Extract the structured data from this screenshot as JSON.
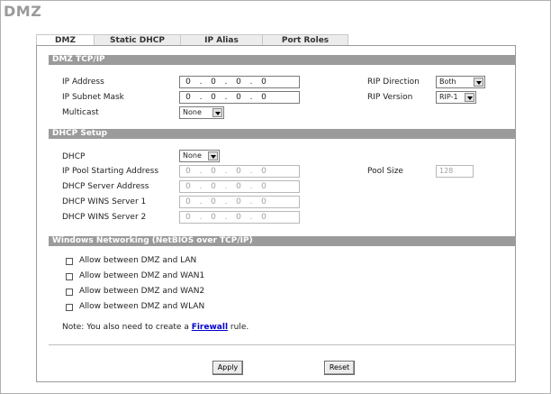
{
  "page": {
    "title": "DMZ"
  },
  "tabs": [
    {
      "label": "DMZ",
      "active": true
    },
    {
      "label": "Static DHCP",
      "active": false
    },
    {
      "label": "IP Alias",
      "active": false
    },
    {
      "label": "Port Roles",
      "active": false
    }
  ],
  "tcpip": {
    "heading": "DMZ TCP/IP",
    "ip_address_label": "IP Address",
    "ip_address": [
      "0",
      "0",
      "0",
      "0"
    ],
    "subnet_mask_label": "IP Subnet Mask",
    "subnet_mask": [
      "0",
      "0",
      "0",
      "0"
    ],
    "multicast_label": "Multicast",
    "multicast_value": "None",
    "rip_direction_label": "RIP Direction",
    "rip_direction_value": "Both",
    "rip_version_label": "RIP Version",
    "rip_version_value": "RIP-1"
  },
  "dhcp": {
    "heading": "DHCP Setup",
    "dhcp_label": "DHCP",
    "dhcp_value": "None",
    "pool_start_label": "IP Pool Starting Address",
    "pool_start": [
      "0",
      "0",
      "0",
      "0"
    ],
    "server_label": "DHCP Server Address",
    "server": [
      "0",
      "0",
      "0",
      "0"
    ],
    "wins1_label": "DHCP WINS Server 1",
    "wins1": [
      "0",
      "0",
      "0",
      "0"
    ],
    "wins2_label": "DHCP WINS Server 2",
    "wins2": [
      "0",
      "0",
      "0",
      "0"
    ],
    "pool_size_label": "Pool Size",
    "pool_size_value": "128"
  },
  "netbios": {
    "heading": "Windows Networking (NetBIOS over TCP/IP)",
    "options": [
      {
        "label": "Allow between DMZ and LAN",
        "checked": false
      },
      {
        "label": "Allow between DMZ and WAN1",
        "checked": false
      },
      {
        "label": "Allow between DMZ and WAN2",
        "checked": false
      },
      {
        "label": "Allow between DMZ and WLAN",
        "checked": false
      }
    ],
    "note_prefix": "Note: You also need to create a ",
    "note_link": "Firewall",
    "note_suffix": " rule."
  },
  "buttons": {
    "apply": "Apply",
    "reset": "Reset"
  }
}
